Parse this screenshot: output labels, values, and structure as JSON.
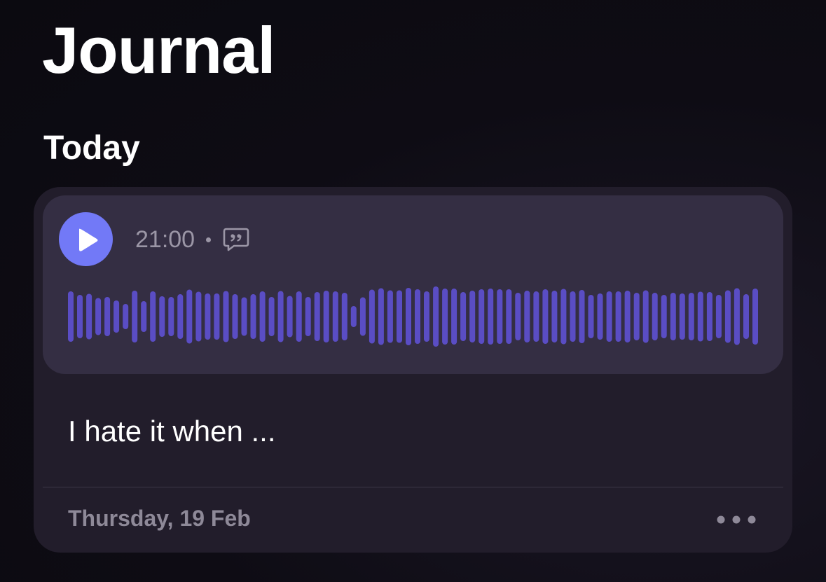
{
  "header": {
    "title": "Journal"
  },
  "section": {
    "title": "Today"
  },
  "entry": {
    "time": "21:00",
    "text": "I hate it when ...",
    "date": "Thursday, 19 Feb",
    "play_icon": "play-icon",
    "transcript_icon": "quote-bubble-icon",
    "more_icon": "ellipsis-icon",
    "waveform_levels": [
      0.72,
      0.62,
      0.65,
      0.53,
      0.56,
      0.46,
      0.36,
      0.74,
      0.44,
      0.72,
      0.58,
      0.56,
      0.64,
      0.77,
      0.71,
      0.66,
      0.66,
      0.73,
      0.64,
      0.55,
      0.64,
      0.72,
      0.56,
      0.73,
      0.59,
      0.72,
      0.56,
      0.7,
      0.74,
      0.72,
      0.68,
      0.3,
      0.55,
      0.77,
      0.81,
      0.75,
      0.75,
      0.82,
      0.78,
      0.72,
      0.86,
      0.8,
      0.8,
      0.7,
      0.74,
      0.78,
      0.8,
      0.78,
      0.78,
      0.68,
      0.74,
      0.72,
      0.78,
      0.74,
      0.79,
      0.72,
      0.76,
      0.62,
      0.66,
      0.72,
      0.72,
      0.74,
      0.68,
      0.75,
      0.68,
      0.62,
      0.68,
      0.66,
      0.68,
      0.71,
      0.7,
      0.62,
      0.75,
      0.81,
      0.64,
      0.8
    ]
  },
  "colors": {
    "accent": "#7279f7",
    "waveform": "#5a4dc4",
    "card": "#221d2b",
    "audio_panel": "#342e43",
    "secondary_text": "#9b96a6"
  }
}
